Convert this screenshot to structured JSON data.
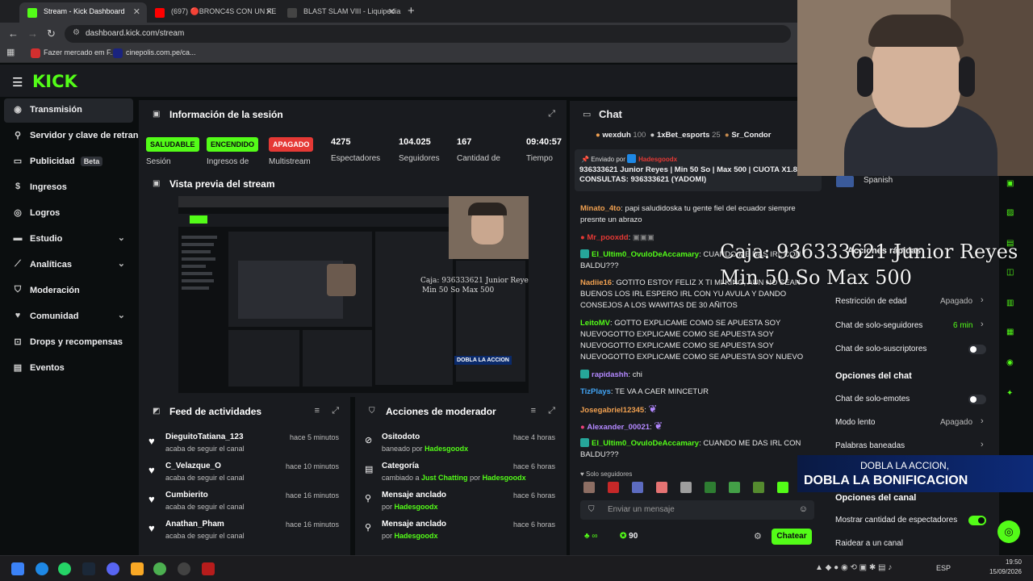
{
  "browser": {
    "tabs": [
      {
        "title": "Stream - Kick Dashboard",
        "active": true
      },
      {
        "title": "(697) 🔴BRONC4S CON UN FE",
        "active": false
      },
      {
        "title": "BLAST SLAM VIII - Liquipedia D",
        "active": false
      }
    ],
    "url": "dashboard.kick.com/stream",
    "bookmarks": [
      "Fazer mercado em F...",
      "cinepolis.com.pe/ca..."
    ]
  },
  "brand": {
    "logo": "KICK",
    "accent": "#53fc18"
  },
  "sidebar": {
    "items": [
      {
        "label": "Transmisión",
        "icon": "broadcast-icon",
        "active": true
      },
      {
        "label": "Servidor y clave de retransmisión",
        "icon": "key-icon"
      },
      {
        "label": "Publicidad",
        "icon": "ad-icon",
        "badge": "Beta"
      },
      {
        "label": "Ingresos",
        "icon": "money-icon"
      },
      {
        "label": "Logros",
        "icon": "trophy-icon"
      },
      {
        "label": "Estudio",
        "icon": "studio-icon",
        "expandable": true
      },
      {
        "label": "Analíticas",
        "icon": "analytics-icon",
        "expandable": true
      },
      {
        "label": "Moderación",
        "icon": "shield-icon"
      },
      {
        "label": "Comunidad",
        "icon": "community-icon",
        "expandable": true
      },
      {
        "label": "Drops y recompensas",
        "icon": "gift-icon"
      },
      {
        "label": "Eventos",
        "icon": "calendar-icon"
      }
    ]
  },
  "session": {
    "title": "Información de la sesión",
    "stats": [
      {
        "badge": "SALUDABLE",
        "label": "Sesión"
      },
      {
        "badge": "ENCENDIDO",
        "label": "Ingresos de"
      },
      {
        "badge": "APAGADO",
        "label": "Multistream"
      },
      {
        "value": "4275",
        "label": "Espectadores"
      },
      {
        "value": "104.025",
        "label": "Seguidores"
      },
      {
        "value": "167",
        "label": "Cantidad de"
      },
      {
        "value": "09:40:57",
        "label": "Tiempo"
      }
    ]
  },
  "preview": {
    "title": "Vista previa del stream",
    "overlay_caja": "Caja: 936333621 Junior Reyes",
    "overlay_minmax": "Min 50 So Max 500",
    "overlay_banner": "DOBLA LA ACCION"
  },
  "activity": {
    "title": "Feed de actividades",
    "items": [
      {
        "name": "DieguitoTatiana_123",
        "text": "acaba de seguir el canal",
        "time": "hace 5 minutos"
      },
      {
        "name": "C_Velazque_O",
        "text": "acaba de seguir el canal",
        "time": "hace 10 minutos"
      },
      {
        "name": "Cumbierito",
        "text": "acaba de seguir el canal",
        "time": "hace 16 minutos"
      },
      {
        "name": "Anathan_Pham",
        "text": "acaba de seguir el canal",
        "time": "hace 16 minutos"
      }
    ]
  },
  "modactions": {
    "title": "Acciones de moderador",
    "items": [
      {
        "name": "Ositodoto",
        "pre": "baneado por",
        "by": "Hadesgoodx",
        "time": "hace 4 horas",
        "icon": "ban-icon"
      },
      {
        "name": "Categoría",
        "pre": "cambiado a",
        "cat": "Just Chatting",
        "mid": "por",
        "by": "Hadesgoodx",
        "time": "hace 6 horas",
        "icon": "category-icon"
      },
      {
        "name": "Mensaje anclado",
        "pre": "por",
        "by": "Hadesgoodx",
        "time": "hace 6 horas",
        "icon": "pin-icon"
      },
      {
        "name": "Mensaje anclado",
        "pre": "por",
        "by": "Hadesgoodx",
        "time": "hace 6 horas",
        "icon": "pin-icon"
      }
    ]
  },
  "chat": {
    "title": "Chat",
    "top_gifters": [
      {
        "name": "wexduh",
        "count": "100"
      },
      {
        "name": "1xBet_esports",
        "count": "25"
      },
      {
        "name": "Sr_Condor",
        "count": ""
      }
    ],
    "pinned": {
      "label": "Enviado por",
      "by": "Hadesgoodx",
      "text": "936333621 Junior Reyes | Min 50 So | Max 500 | CUOTA X1.8 | CONSULTAS: 936333621 (YADOMI)"
    },
    "messages": [
      {
        "user": "Minato_4to",
        "color": "#f0a050",
        "text": "papi saludidoska tu gente fiel del ecuador siempre presnte un abrazo"
      },
      {
        "user": "Mr_pooxdd",
        "color": "#e53935",
        "text": ""
      },
      {
        "user": "El_Ultim0_OvuloDeAccamary",
        "color": "#53fc18",
        "text": "CUANDO ME DAS IRL CON BALDU???",
        "mod": true
      },
      {
        "user": "Nadiie16",
        "color": "#f0a050",
        "text": "GOTITO ESTOY FELIZ X TI MI KING, AUN NO SEAN BUENOS LOS IRL ESPERO IRL CON YU AVULA Y DANDO CONSEJOS A LOS WAWITAS DE 30 AÑITOS"
      },
      {
        "user": "LeitoMV",
        "color": "#53fc18",
        "text": "GOTTO EXPLICAME COMO SE APUESTA SOY NUEVOGOTTO EXPLICAME COMO SE APUESTA SOY NUEVOGOTTO EXPLICAME COMO SE APUESTA SOY NUEVOGOTTO EXPLICAME COMO SE APUESTA SOY NUEVO"
      },
      {
        "user": "rapidashh",
        "color": "#b388ff",
        "text": "chi",
        "mod": true
      },
      {
        "user": "TizPlays",
        "color": "#42a5f5",
        "text": "TE VA A CAER MINCETUR"
      },
      {
        "user": "Josegabriel12345",
        "color": "#f0a050",
        "text": ""
      },
      {
        "user": "Alexander_00021",
        "color": "#b388ff",
        "text": ""
      },
      {
        "user": "El_Ultim0_OvuloDeAccamary",
        "color": "#53fc18",
        "text": "CUANDO ME DAS IRL CON BALDU???",
        "mod": true
      }
    ],
    "followers_only": "Solo seguidores",
    "placeholder": "Enviar un mensaje",
    "send": "Chatear",
    "points": "90"
  },
  "settings": {
    "language": "Spanish",
    "heading_actions": "Acciones rápidas",
    "heading_chat": "Opciones del chat",
    "heading_channel": "Opciones del canal",
    "items": [
      {
        "label": "Restricción de edad",
        "value": "Apagado"
      },
      {
        "label": "Chat de solo-seguidores",
        "value": "6 min"
      },
      {
        "label": "Chat de solo-suscriptores",
        "toggle": false
      },
      {
        "label": "Chat de solo-emotes",
        "toggle": false
      },
      {
        "label": "Modo lento",
        "value": "Apagado"
      },
      {
        "label": "Palabras baneadas",
        "value": ""
      },
      {
        "label": "Mostrar cantidad de espectadores",
        "toggle": true
      },
      {
        "label": "Raidear a un canal",
        "value": ""
      }
    ]
  },
  "overlay": {
    "caja": "Caja: 936333621 Junior Reyes",
    "minmax": "Min 50 So Max 500",
    "banner_top": "DOBLA LA ACCION,",
    "banner_bottom": "DOBLA LA BONIFICACION"
  },
  "taskbar": {
    "lang": "ESP",
    "time": "19:50",
    "date": "15/09/2026"
  }
}
